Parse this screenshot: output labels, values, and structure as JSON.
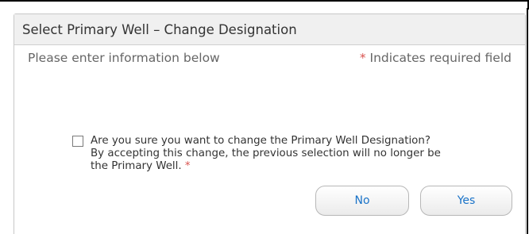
{
  "dialog": {
    "title": "Select Primary Well – Change Designation",
    "instruction": "Please enter information below",
    "required_star": "*",
    "required_note": "Indicates required field",
    "confirm_line1": "Are you sure you want to change the Primary Well Designation?",
    "confirm_line2": "By accepting this change, the previous selection will no longer be",
    "confirm_line3": "the Primary Well.",
    "confirm_star": "*",
    "checkbox_checked": false,
    "no_label": "No",
    "yes_label": "Yes"
  },
  "colors": {
    "required": "#d9534f",
    "button_text": "#1a73c8",
    "titlebar_bg": "#f0f0f0"
  }
}
